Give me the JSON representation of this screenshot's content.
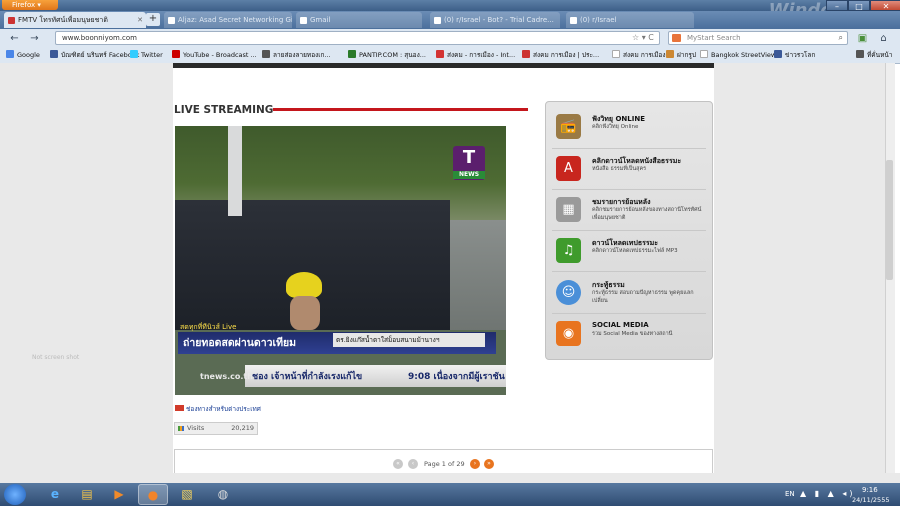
{
  "browser": {
    "menu_button": "Firefox",
    "tabs": [
      {
        "label": "FMTV โทรทัศน์เพื่อมนุษยชาติ"
      },
      {
        "label": "Aljaz: Asad Secret Networking Gi..."
      },
      {
        "label": "Gmail"
      },
      {
        "label": "(0) r/Israel - Bot? - Trial Cadre..."
      },
      {
        "label": "(0) r/Israel"
      }
    ],
    "new_tab": "+",
    "url": "www.boonniyom.com",
    "search_placeholder": "MyStart Search",
    "nav": {
      "back": "←",
      "forward": "→",
      "home": "⌂"
    },
    "win_logo": "Windows",
    "window_controls": {
      "minimize": "–",
      "maximize": "□",
      "close": "✕"
    },
    "bookmarks": [
      {
        "label": "Google",
        "color": "#4a86e8"
      },
      {
        "label": "บัณฑิตย์ นรินทร์ Facebook",
        "color": "#3b5998"
      },
      {
        "label": "Twitter",
        "color": "#33ccff"
      },
      {
        "label": "YouTube - Broadcast ...",
        "color": "#cc0000"
      },
      {
        "label": "ลายส่องลายทองเก...",
        "color": "#555555"
      },
      {
        "label": "PANTIP.COM : สุนอง...",
        "color": "#2a7a2a"
      },
      {
        "label": "ส่งคม - การเมือง - Int...",
        "color": "#d33333"
      },
      {
        "label": "ส่งคม การเมือง | ประ...",
        "color": "#cc3333"
      },
      {
        "label": "ส่งคม การเมือง",
        "color": "#ffffff"
      },
      {
        "label": "ฝากรูป",
        "color": "#cc8833"
      },
      {
        "label": "Bangkok StreetView",
        "color": "#ffffff"
      },
      {
        "label": "ข่าวรวโลก",
        "color": "#3b5998"
      },
      {
        "label": "ที่คั่นหน้า",
        "color": "#555555"
      }
    ]
  },
  "main": {
    "section_title": "LIVE STREAMING",
    "video": {
      "logo_letter": "T",
      "logo_sub": "NEWS",
      "live_tag": "สดทุกที่ทีนิวส์ Live",
      "caption_main": "ถ่ายทอดสดผ่านดาวเทียม",
      "caption_sub": "ตร.ยิงแก๊สน้ำตาใส่ม็อบสนามม้านางฯ",
      "ticker": "ชอง เจ้าหน้าที่กำลังเรงแก้ไข",
      "ticker_time": "9:08  เนื่องจากมีผู้เราชัน",
      "site": "tnews.co.th"
    },
    "foreign_link": "ช่องทางสำหรับต่างประเทศ",
    "visits_label": "Visits",
    "visits_value": "20,219",
    "pager_text": "Page 1 of 29",
    "ghost_text": "Not screen shot"
  },
  "sidebar": {
    "items": [
      {
        "title": "ฟังวิทยุ ONLINE",
        "sub": "คลิกฟังวิทยุ Online",
        "icon": "radio-icon",
        "color": "#9a7a45",
        "glyph": "📻"
      },
      {
        "title": "คลิกดาวน์โหลดหนังสือธรรมะ",
        "sub": "หนังสือ ธรรมที่เป็นสุคร",
        "icon": "pdf-icon",
        "color": "#c8261e",
        "glyph": "A"
      },
      {
        "title": "ชมรายการย้อนหลัง",
        "sub": "คลิกชมรายการย้อนหลังของทางสถานีโทรทัศน์เพื่อมนุษยชาติ",
        "icon": "film-icon",
        "color": "#9a9a9a",
        "glyph": "▦"
      },
      {
        "title": "ดาวน์โหลดเทปธรรมะ",
        "sub": "คลิกดาวน์โหลดเทปธรรมะไฟล์ MP3",
        "icon": "music-icon",
        "color": "#3f9b2c",
        "glyph": "♫"
      },
      {
        "title": "กระทู้ธรรม",
        "sub": "กระทู้ธรรม สอบถามปัญหาธรรม พูดคุยแลกเปลี่ยน",
        "icon": "chat-icon",
        "color": "#4a8fd8",
        "glyph": "☺"
      },
      {
        "title": "SOCIAL MEDIA",
        "sub": "รวม Social Media ของทางสถานี",
        "icon": "rss-icon",
        "color": "#e8741f",
        "glyph": "◉"
      }
    ]
  },
  "taskbar": {
    "lang": "EN",
    "time": "9:16",
    "date": "24/11/2555",
    "tray": "▲ ▮ ▲ ◂)"
  }
}
